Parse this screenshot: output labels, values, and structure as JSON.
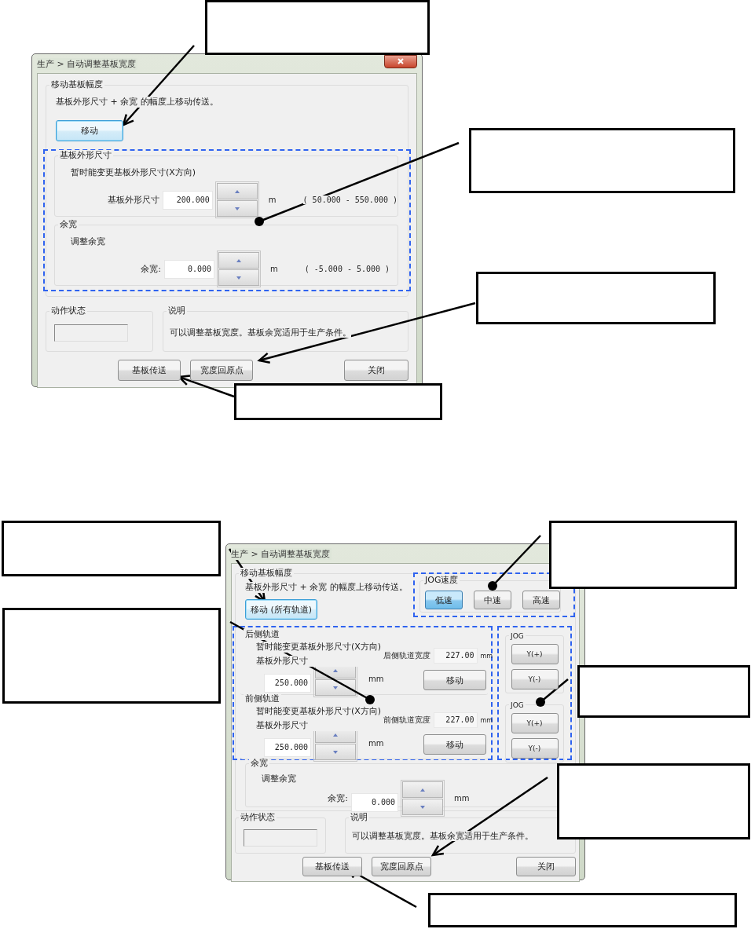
{
  "upper_dialog": {
    "title": "生产 > 自动调整基板宽度",
    "move_group": {
      "title": "移动基板幅度",
      "text": "基板外形尺寸 + 余宽 的幅度上移动传送。",
      "button": {
        "label": "移动",
        "focused": true
      }
    },
    "size_group": {
      "title": "基板外形尺寸",
      "hint": "暂时能变更基板外形尺寸(X方向)",
      "label": "基板外形尺寸",
      "value": "200.000",
      "unit": "m",
      "range": "( 50.000 - 550.000 )"
    },
    "margin_group": {
      "title": "余宽",
      "hint": "调整余宽",
      "label": "余宽:",
      "value": "0.000",
      "unit": "m",
      "range": "( -5.000 - 5.000 )"
    },
    "status_group": {
      "title": "动作状态"
    },
    "info_group": {
      "title": "说明",
      "text": "可以调整基板宽度。基板余宽适用于生产条件。"
    },
    "buttons": [
      {
        "label": "基板传送"
      },
      {
        "label": "宽度回原点"
      },
      {
        "label": "关闭"
      }
    ]
  },
  "lower_dialog": {
    "title": "生产 > 自动调整基板宽度",
    "move_group": {
      "title": "移动基板幅度",
      "text": "基板外形尺寸 + 余宽 的幅度上移动传送。",
      "button": {
        "label": "移动 (所有轨道)",
        "focused": true
      }
    },
    "speed_group": {
      "title": "JOG速度",
      "options": [
        {
          "label": "低速",
          "selected": true
        },
        {
          "label": "中速",
          "selected": false
        },
        {
          "label": "高速",
          "selected": false
        }
      ]
    },
    "rails": [
      {
        "title": "后侧轨道",
        "hint": "暂时能变更基板外形尺寸(X方向)",
        "label": "基板外形尺寸",
        "value": "250.000",
        "unit": "mm",
        "width_label": "后侧轨道宽度",
        "width_value": "227.00",
        "width_unit": "mm",
        "button": "移动"
      },
      {
        "title": "前侧轨道",
        "hint": "暂时能变更基板外形尺寸(X方向)",
        "label": "基板外形尺寸",
        "value": "250.000",
        "unit": "mm",
        "width_label": "前侧轨道宽度",
        "width_value": "227.00",
        "width_unit": "mm",
        "button": "移动"
      }
    ],
    "jog_groups": [
      {
        "title": "JOG",
        "buttons": [
          "Y(+)",
          "Y(-)"
        ]
      },
      {
        "title": "JOG",
        "buttons": [
          "Y(+)",
          "Y(-)"
        ]
      }
    ],
    "margin_group": {
      "title": "余宽",
      "hint": "调整余宽",
      "label": "余宽:",
      "value": "0.000",
      "unit": "mm"
    },
    "status_group": {
      "title": "动作状态"
    },
    "info_group": {
      "title": "说明",
      "text": "可以调整基板宽度。基板余宽适用于生产条件。"
    },
    "buttons": [
      {
        "label": "基板传送"
      },
      {
        "label": "宽度回原点"
      },
      {
        "label": "关闭"
      }
    ]
  }
}
